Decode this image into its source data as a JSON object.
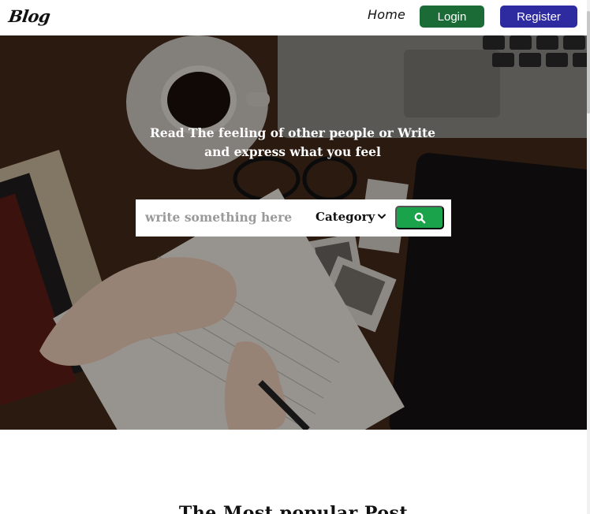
{
  "header": {
    "brand": "Blog",
    "nav": {
      "home": "Home"
    },
    "login_label": "Login",
    "register_label": "Register"
  },
  "hero": {
    "tagline": "Read The feeling of other people or Write and express what you feel",
    "search": {
      "placeholder": "write something here",
      "category_label": "Category",
      "search_icon": "search-icon"
    }
  },
  "main": {
    "section_title": "The Most popular Post"
  },
  "colors": {
    "login": "#1a6b35",
    "register": "#2e2aa0",
    "search_button": "#1aa34a"
  }
}
